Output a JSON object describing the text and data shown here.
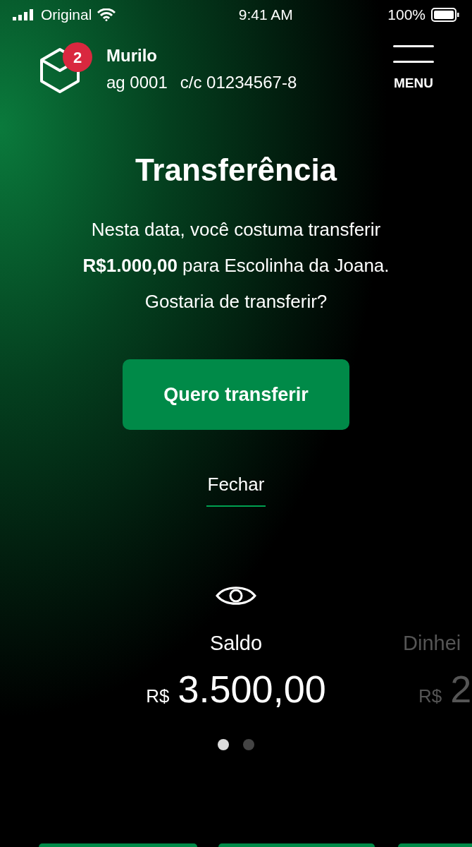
{
  "status_bar": {
    "carrier": "Original",
    "time": "9:41 AM",
    "battery": "100%"
  },
  "header": {
    "notifications": "2",
    "name": "Murilo",
    "agency": "ag 0001",
    "account": "c/c 01234567-8",
    "menu": "MENU"
  },
  "suggestion": {
    "title": "Transferência",
    "message": "Nesta data, você costuma transferir **R$1.000,00** para Escolinha da Joana. Gostaria de transferir?",
    "primary_button": "Quero transferir",
    "close_link": "Fechar"
  },
  "balances": [
    {
      "label": "Saldo",
      "currency": "R$",
      "amount": "3.500,00",
      "selected": true
    },
    {
      "label": "Dinhei",
      "currency": "R$",
      "amount": "2",
      "selected": false
    }
  ],
  "pages": [
    {
      "selected": true
    },
    {
      "selected": false
    }
  ]
}
